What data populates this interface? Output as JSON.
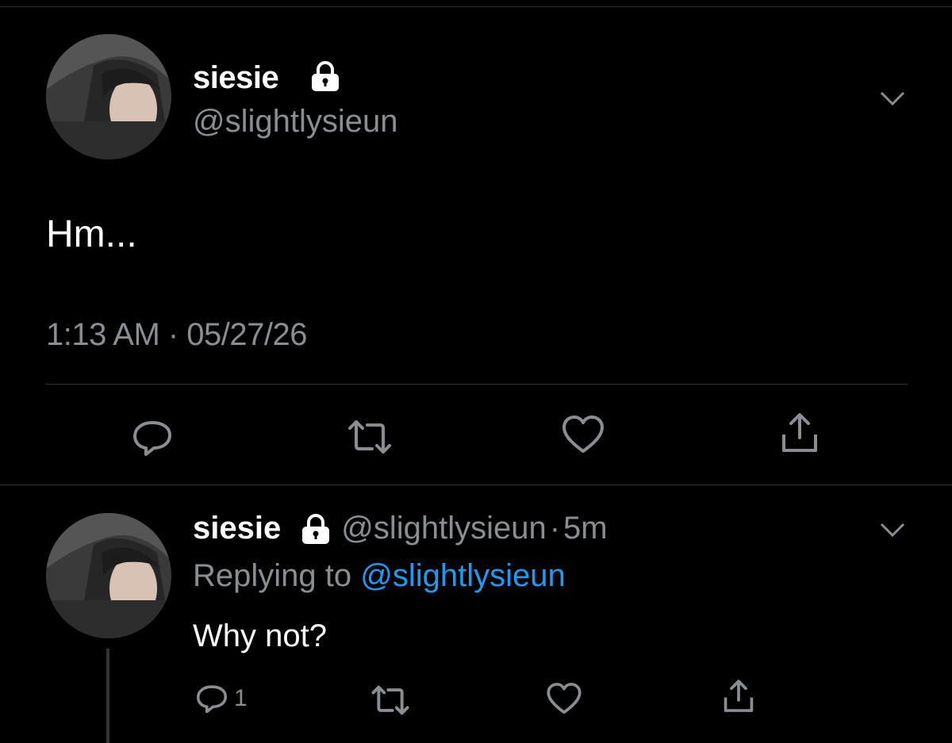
{
  "tweet": {
    "display_name": "siesie",
    "handle": "@slightlysieun",
    "text": "Hm...",
    "timestamp": "1:13 AM · 05/27/26"
  },
  "reply": {
    "display_name": "siesie",
    "handle": "@slightlysieun",
    "dot": "·",
    "time": "5m",
    "replying_prefix": "Replying to",
    "replying_handle": "@slightlysieun",
    "text": "Why not?",
    "reply_count": "1"
  },
  "icons": {
    "lock": "lock-icon",
    "chevron": "chevron-down-icon",
    "reply": "reply-icon",
    "retweet": "retweet-icon",
    "like": "heart-icon",
    "share": "share-icon"
  },
  "colors": {
    "background": "#000000",
    "text_primary": "#ffffff",
    "text_secondary": "#8a8d91",
    "mention": "#1d9bf0"
  }
}
